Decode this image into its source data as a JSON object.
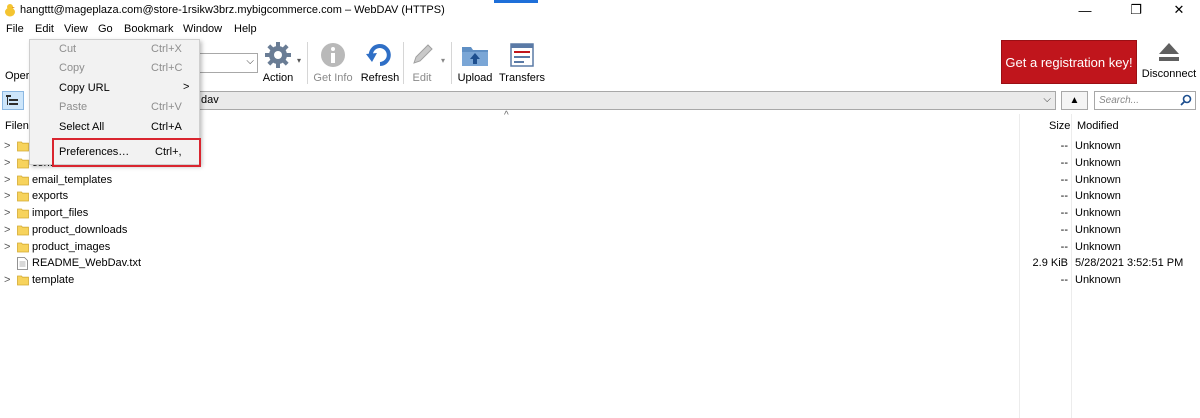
{
  "window": {
    "title": "hangttt@mageplaza.com@store-1rsikw3brz.mybigcommerce.com – WebDAV (HTTPS)",
    "minimize_glyph": "—",
    "maximize_glyph": "❐",
    "close_glyph": "✕"
  },
  "menubar": {
    "items": [
      "File",
      "Edit",
      "View",
      "Go",
      "Bookmark",
      "Window",
      "Help"
    ]
  },
  "edit_menu": {
    "items": [
      {
        "label": "Cut",
        "shortcut": "Ctrl+X",
        "enabled": false
      },
      {
        "label": "Copy",
        "shortcut": "Ctrl+C",
        "enabled": false
      },
      {
        "label": "Copy URL",
        "shortcut": "",
        "enabled": true,
        "submenu": true
      },
      {
        "label": "Paste",
        "shortcut": "Ctrl+V",
        "enabled": false
      },
      {
        "label": "Select All",
        "shortcut": "Ctrl+A",
        "enabled": true
      },
      {
        "label": "Preferences…",
        "shortcut": "Ctrl+,",
        "enabled": true
      }
    ],
    "submenu_glyph": ">"
  },
  "toolbar": {
    "open_label": "Oper",
    "action_label": "Action",
    "get_info_label": "Get Info",
    "refresh_label": "Refresh",
    "edit_label": "Edit",
    "upload_label": "Upload",
    "transfers_label": "Transfers",
    "registration_label": "Get a registration key!",
    "disconnect_label": "Disconnect"
  },
  "pathbar": {
    "path_text": "dav",
    "search_placeholder": "Search..."
  },
  "list": {
    "header_filename": "Filen",
    "header_size": "Size",
    "header_modified": "Modified",
    "sort_indicator": "^",
    "rows": [
      {
        "name": "",
        "type": "folder",
        "size": "--",
        "modified": "Unknown"
      },
      {
        "name": "content",
        "type": "folder",
        "size": "--",
        "modified": "Unknown"
      },
      {
        "name": "email_templates",
        "type": "folder",
        "size": "--",
        "modified": "Unknown"
      },
      {
        "name": "exports",
        "type": "folder",
        "size": "--",
        "modified": "Unknown"
      },
      {
        "name": "import_files",
        "type": "folder",
        "size": "--",
        "modified": "Unknown"
      },
      {
        "name": "product_downloads",
        "type": "folder",
        "size": "--",
        "modified": "Unknown"
      },
      {
        "name": "product_images",
        "type": "folder",
        "size": "--",
        "modified": "Unknown"
      },
      {
        "name": "README_WebDav.txt",
        "type": "file",
        "size": "2.9 KiB",
        "modified": "5/28/2021 3:52:51 PM"
      },
      {
        "name": "template",
        "type": "folder",
        "size": "--",
        "modified": "Unknown"
      }
    ]
  },
  "colors": {
    "highlight_red": "#d9252f",
    "registration_bg": "#c0151c",
    "folder_yellow": "#f7d35c"
  }
}
